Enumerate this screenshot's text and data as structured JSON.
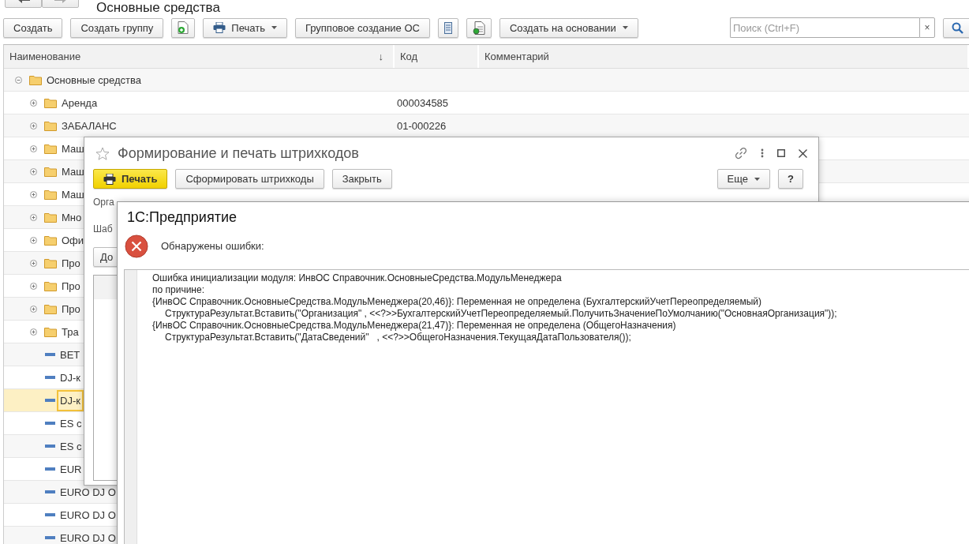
{
  "window": {
    "title": "Основные средства"
  },
  "toolbar": [
    {
      "kind": "button",
      "label": "Создать"
    },
    {
      "kind": "button",
      "label": "Создать группу"
    },
    {
      "kind": "add"
    },
    {
      "kind": "print",
      "label": "Печать"
    },
    {
      "kind": "button",
      "label": "Групповое создание ОС"
    },
    {
      "kind": "list"
    },
    {
      "kind": "report"
    },
    {
      "kind": "menu",
      "label": "Создать на основании"
    }
  ],
  "search": {
    "placeholder": "Поиск (Ctrl+F)",
    "clear": "×"
  },
  "table": {
    "columns": [
      {
        "label": "Наименование",
        "sort": "↓"
      },
      {
        "label": "Код"
      },
      {
        "label": "Комментарий"
      }
    ],
    "rows": [
      {
        "kind": "group",
        "name": "Основные средства",
        "expanded": true,
        "selected": false,
        "children": [
          {
            "kind": "group",
            "name": "Аренда",
            "code": "000034585",
            "expanded": false,
            "selected": false
          },
          {
            "kind": "group",
            "name": "ЗАБАЛАНС",
            "code": "01-000226",
            "expanded": false,
            "selected": false
          },
          {
            "kind": "group",
            "name": "Маш",
            "expanded": false,
            "selected": false
          },
          {
            "kind": "group",
            "name": "Маш",
            "expanded": false,
            "selected": false
          },
          {
            "kind": "group",
            "name": "Маш",
            "expanded": false,
            "selected": false
          },
          {
            "kind": "group",
            "name": "Мно",
            "expanded": false,
            "selected": false
          },
          {
            "kind": "group",
            "name": "Офи",
            "expanded": false,
            "selected": false
          },
          {
            "kind": "group",
            "name": "Про",
            "expanded": false,
            "selected": false
          },
          {
            "kind": "group",
            "name": "Про",
            "expanded": false,
            "selected": false
          },
          {
            "kind": "group",
            "name": "Про",
            "expanded": false,
            "selected": false
          },
          {
            "kind": "group",
            "name": "Тра",
            "expanded": false,
            "selected": false
          },
          {
            "kind": "item",
            "name": "BET",
            "selected": false
          },
          {
            "kind": "item",
            "name": "DJ-к",
            "selected": false
          },
          {
            "kind": "item",
            "name": "DJ-к",
            "selected": true
          },
          {
            "kind": "item",
            "name": "ES с",
            "selected": false
          },
          {
            "kind": "item",
            "name": "ES с",
            "selected": false
          },
          {
            "kind": "item",
            "name": "EUR",
            "selected": false
          },
          {
            "kind": "item",
            "name": "EURO DJ O",
            "selected": false
          },
          {
            "kind": "item",
            "name": "EURO DJ O",
            "selected": false
          },
          {
            "kind": "item",
            "name": "EURO DJ O",
            "selected": false
          }
        ]
      }
    ]
  },
  "form": {
    "title": "Формирование и печать штрихкодов",
    "buttons": [
      {
        "kind": "print",
        "label": "Печать",
        "default": true
      },
      {
        "kind": "button",
        "label": "Сформировать штрихкоды",
        "default": false
      },
      {
        "kind": "button",
        "label": "Закрыть",
        "default": false
      }
    ],
    "more": "Еще",
    "help": "?",
    "labels": [
      "Орга",
      "Шаб"
    ],
    "add_button": "До"
  },
  "dialog": {
    "title": "1С:Предприятие",
    "message": "Обнаружены ошибки:",
    "details": [
      {
        "kind": "head",
        "text": "Ошибка инициализации модуля: ИнвОС Справочник.ОсновныеСредства.МодульМенеджера"
      },
      {
        "kind": "head",
        "text": "по причине:"
      },
      {
        "kind": "head",
        "text": "{ИнвОС Справочник.ОсновныеСредства.МодульМенеджера(20,46)}: Переменная не определена (БухгалтерскийУчетПереопределяемый)"
      },
      {
        "kind": "code",
        "text": "СтруктураРезультат.Вставить(\"Организация\" , <<?>>БухгалтерскийУчетПереопределяемый.ПолучитьЗначениеПоУмолчанию(\"ОсновнаяОрганизация\"));"
      },
      {
        "kind": "head",
        "text": "{ИнвОС Справочник.ОсновныеСредства.МодульМенеджера(21,47)}: Переменная не определена (ОбщегоНазначения)"
      },
      {
        "kind": "code",
        "text": "СтруктураРезультат.Вставить(\"ДатаСведений\"   , <<?>>ОбщегоНазначения.ТекущаяДатаПользователя());"
      }
    ]
  }
}
